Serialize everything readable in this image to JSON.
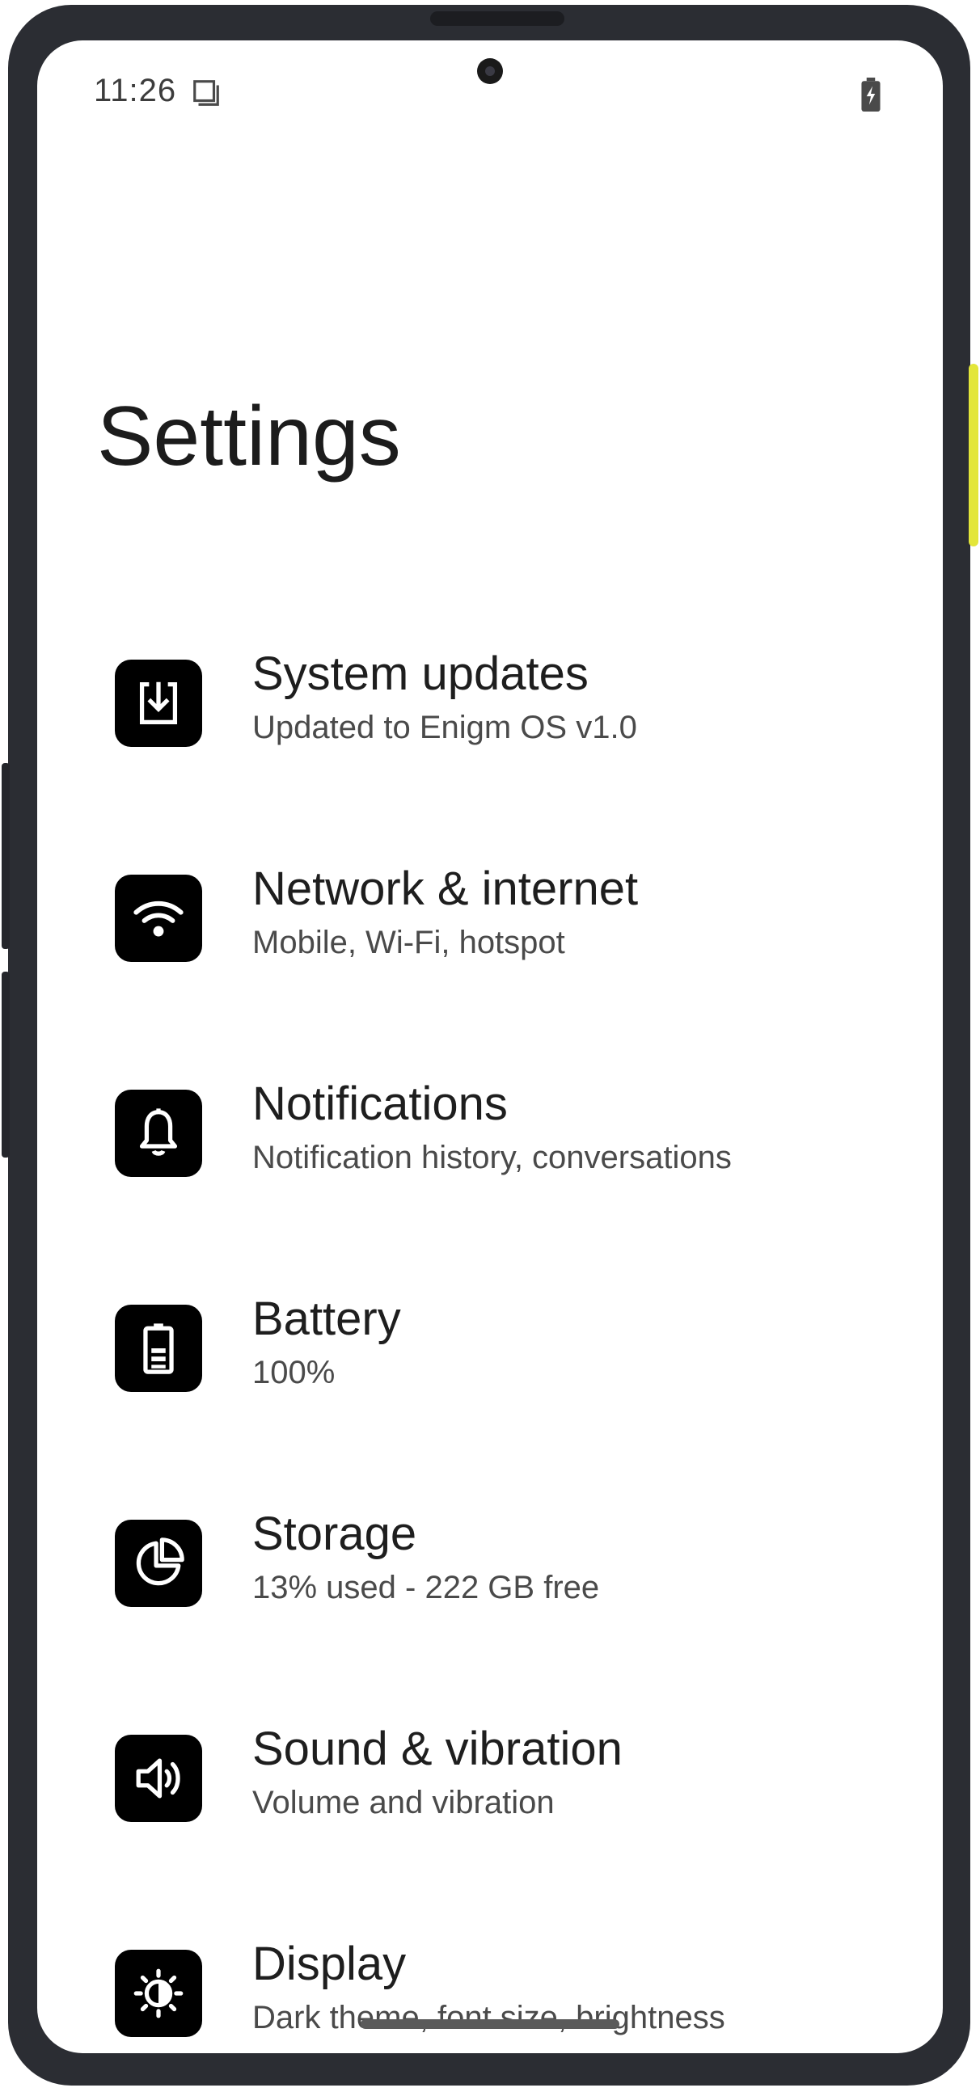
{
  "status_bar": {
    "time": "11:26",
    "notification_icon": "note-icon",
    "battery_icon": "battery-charging-icon"
  },
  "page": {
    "title": "Settings"
  },
  "items": [
    {
      "icon": "system-update-icon",
      "title": "System updates",
      "summary": "Updated to Enigm OS v1.0"
    },
    {
      "icon": "wifi-icon",
      "title": "Network & internet",
      "summary": "Mobile, Wi-Fi, hotspot"
    },
    {
      "icon": "bell-icon",
      "title": "Notifications",
      "summary": "Notification history, conversations"
    },
    {
      "icon": "battery-icon",
      "title": "Battery",
      "summary": "100%"
    },
    {
      "icon": "storage-pie-icon",
      "title": "Storage",
      "summary": "13% used - 222 GB free"
    },
    {
      "icon": "speaker-icon",
      "title": "Sound & vibration",
      "summary": "Volume and vibration"
    },
    {
      "icon": "brightness-icon",
      "title": "Display",
      "summary": "Dark theme, font size, brightness"
    }
  ],
  "colors": {
    "frame": "#2b2d33",
    "accent_button": "#e3e63a",
    "tile": "#000000",
    "title_text": "#1e1e1e",
    "summary_text": "#4a4a4a"
  }
}
